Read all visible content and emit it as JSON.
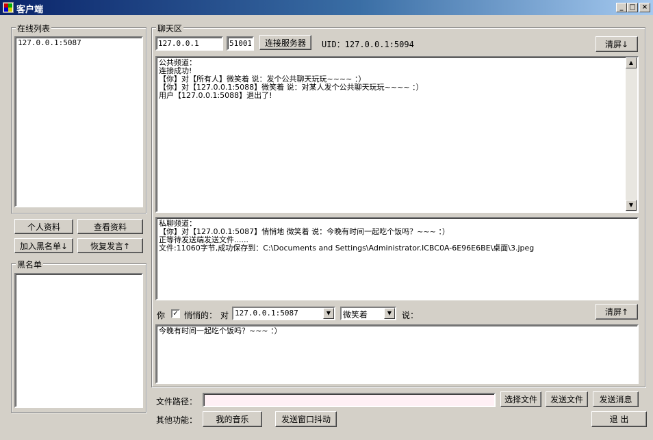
{
  "window": {
    "title": "客户端"
  },
  "titlebar": {
    "min": "_",
    "max": "□",
    "close": "×"
  },
  "online": {
    "group_label": "在线列表",
    "items": [
      "127.0.0.1:5087"
    ]
  },
  "left_buttons": {
    "profile": "个人资料",
    "view_profile": "查看资料",
    "add_blacklist": "加入黑名单↓",
    "restore_speech": "恢复发言↑"
  },
  "blacklist": {
    "group_label": "黑名单"
  },
  "chat": {
    "group_label": "聊天区",
    "ip_value": "127.0.0.1",
    "port_value": "51001",
    "connect": "连接服务器",
    "uid": "UID：127.0.0.1:5094",
    "clear_top": "清屏↓",
    "public_lines": [
      "公共频道：",
      "连接成功!",
      "【你】对【所有人】微笑着 说：发个公共聊天玩玩~~~~ ：）",
      "【你】对【127.0.0.1:5088】微笑着 说：对某人发个公共聊天玩玩~~~~ ：）",
      "用户【127.0.0.1:5088】退出了!"
    ],
    "private_lines": [
      "私聊频道：",
      "【你】对【127.0.0.1:5087】悄悄地 微笑着 说：今晚有时间一起吃个饭吗？~~~ ：）",
      "正等待发送端发送文件......",
      "文件:11060字节,成功保存到：C:\\Documents and Settings\\Administrator.ICBC0A-6E96E6BE\\桌面\\3.jpeg"
    ],
    "you_label": "你",
    "whisper_label": "悄悄的：",
    "whisper_checked": "✓",
    "to_label": "对",
    "target_value": "127.0.0.1:5087",
    "expression_value": "微笑着",
    "say_label": "说：",
    "clear_bottom": "清屏↑",
    "message_value": "今晚有时间一起吃个饭吗？~~~ ：）"
  },
  "bottom": {
    "file_path_label": "文件路径：",
    "file_path_value": "",
    "choose_file": "选择文件",
    "send_file": "发送文件",
    "send_message": "发送消息",
    "other_label": "其他功能：",
    "my_music": "我的音乐",
    "shake": "发送窗口抖动",
    "exit": "退 出"
  },
  "colors": {
    "window_bg": "#d4d0c8",
    "titlebar_start": "#0a246a",
    "titlebar_end": "#a6caf0",
    "file_path_bg": "#fff0f5"
  }
}
